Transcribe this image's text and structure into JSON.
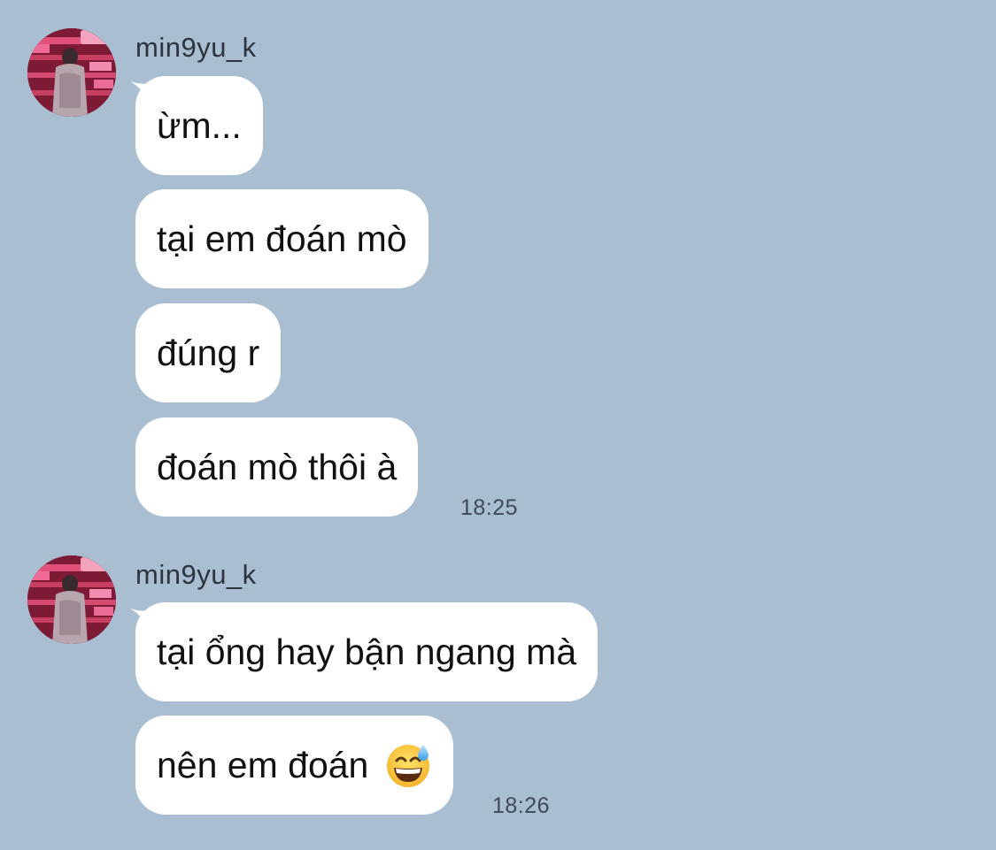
{
  "groups": [
    {
      "username": "min9yu_k",
      "messages": [
        "ừm...",
        "tại em đoán mò",
        "đúng r",
        "đoán mò thôi à"
      ],
      "time": "18:25"
    },
    {
      "username": "min9yu_k",
      "messages": [
        "tại ổng hay bận ngang mà",
        "nên em đoán"
      ],
      "emoji": "grinning-face-with-sweat-icon",
      "time": "18:26"
    }
  ],
  "colors": {
    "background": "#a9bfd1",
    "bubble": "#ffffff",
    "text": "#111111",
    "meta": "#3e4a57"
  }
}
